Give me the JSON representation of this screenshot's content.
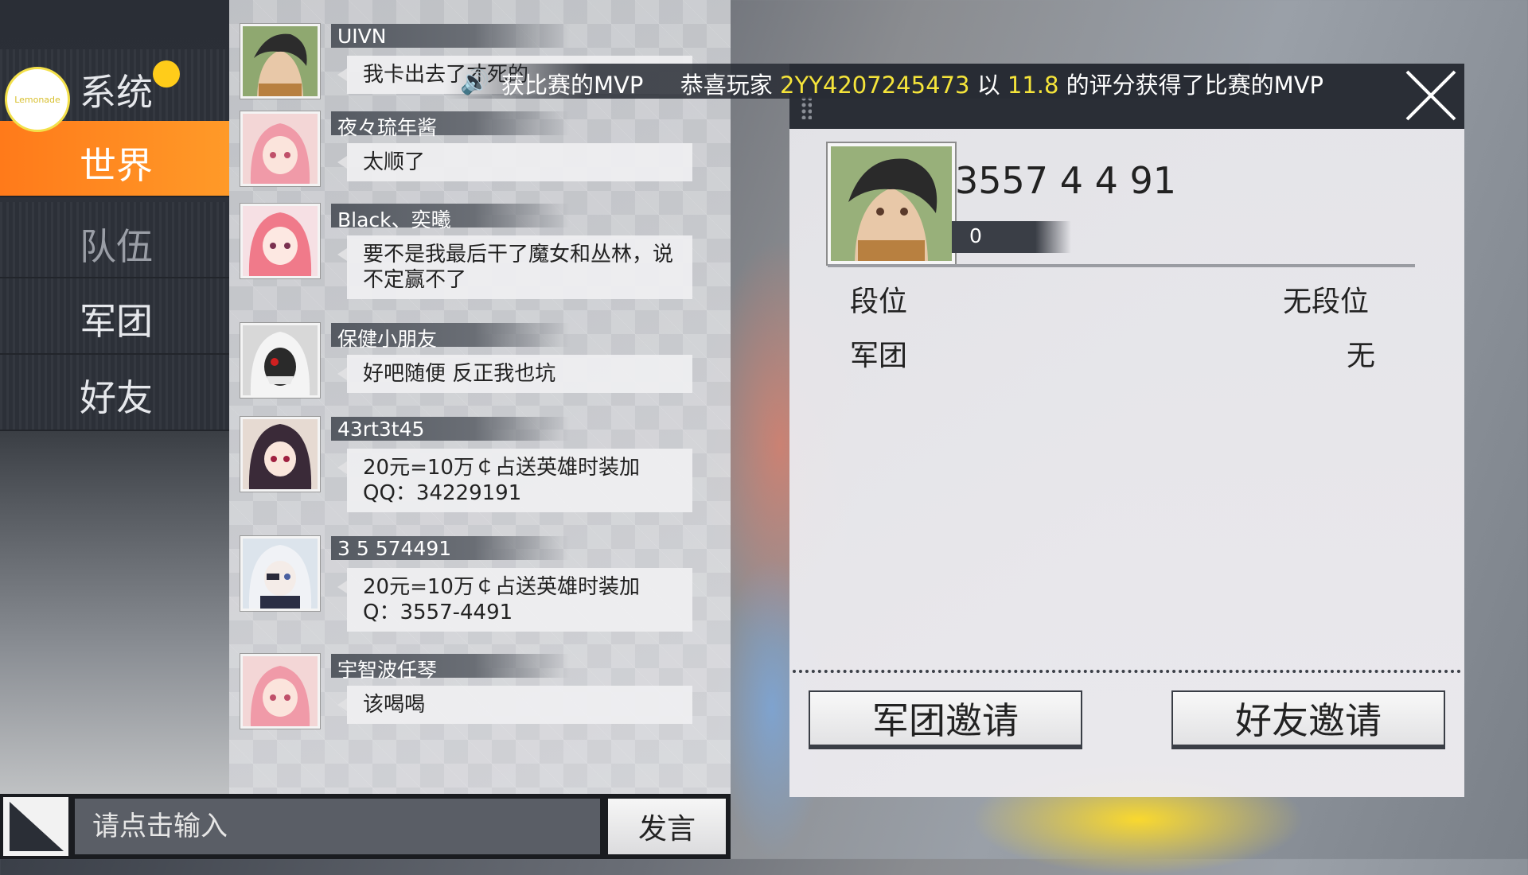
{
  "sidebar": {
    "logo_text": "Lemonade",
    "items": [
      {
        "label": "系统"
      },
      {
        "label": "世界"
      },
      {
        "label": "队伍"
      },
      {
        "label": "军团"
      },
      {
        "label": "好友"
      }
    ]
  },
  "chat": {
    "messages": [
      {
        "name": "UIVN",
        "text": "我卡出去了才死的"
      },
      {
        "name": "夜々琉年酱",
        "text": "太顺了"
      },
      {
        "name": "Black、奕曦",
        "text": "要不是我最后干了魔女和丛林，说不定赢不了"
      },
      {
        "name": "保健小朋友",
        "text": "好吧随便 反正我也坑"
      },
      {
        "name": "43rt3t45",
        "text": "20元=10万￠占送英雄时装加QQ：34229191"
      },
      {
        "name": "3 5 574491",
        "text": "20元=10万￠占送英雄时装加Q：3557-4491"
      },
      {
        "name": "宇智波任琴",
        "text": "该喝喝"
      }
    ],
    "input_placeholder": "请点击输入",
    "send_label": "发言"
  },
  "banner": {
    "prefix": "获比赛的MVP",
    "congrats": "恭喜玩家",
    "player": "2YY4207245473",
    "mid": "以",
    "score": "11.8",
    "suffix": "的评分获得了比赛的MVP"
  },
  "profile": {
    "player_id": "3557 4 4 91",
    "level": "0",
    "rank_label": "段位",
    "rank_value": "无段位",
    "legion_label": "军团",
    "legion_value": "无",
    "legion_invite": "军团邀请",
    "friend_invite": "好友邀请"
  },
  "colors": {
    "accent_orange": "#ff8a1f",
    "highlight_yellow": "#f5e43a",
    "dark_panel": "#2a2e36"
  }
}
